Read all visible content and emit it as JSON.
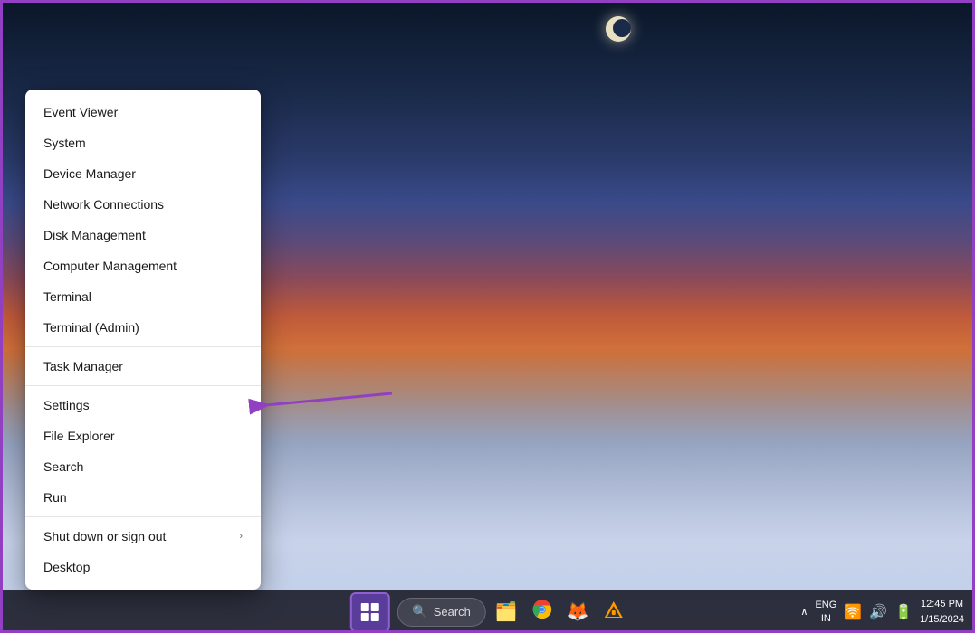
{
  "desktop": {
    "background_desc": "Winter landscape at dusk with snow fields"
  },
  "context_menu": {
    "items": [
      {
        "id": "event-viewer",
        "label": "Event Viewer",
        "has_submenu": false
      },
      {
        "id": "system",
        "label": "System",
        "has_submenu": false
      },
      {
        "id": "device-manager",
        "label": "Device Manager",
        "has_submenu": false
      },
      {
        "id": "network-connections",
        "label": "Network Connections",
        "has_submenu": false
      },
      {
        "id": "disk-management",
        "label": "Disk Management",
        "has_submenu": false
      },
      {
        "id": "computer-management",
        "label": "Computer Management",
        "has_submenu": false
      },
      {
        "id": "terminal",
        "label": "Terminal",
        "has_submenu": false
      },
      {
        "id": "terminal-admin",
        "label": "Terminal (Admin)",
        "has_submenu": false
      },
      {
        "id": "task-manager",
        "label": "Task Manager",
        "has_submenu": false
      },
      {
        "id": "settings",
        "label": "Settings",
        "has_submenu": false,
        "highlighted": true
      },
      {
        "id": "file-explorer",
        "label": "File Explorer",
        "has_submenu": false
      },
      {
        "id": "search",
        "label": "Search",
        "has_submenu": false
      },
      {
        "id": "run",
        "label": "Run",
        "has_submenu": false
      },
      {
        "id": "shut-down",
        "label": "Shut down or sign out",
        "has_submenu": true
      },
      {
        "id": "desktop",
        "label": "Desktop",
        "has_submenu": false
      }
    ],
    "divider_after": [
      "terminal-admin",
      "task-manager",
      "run"
    ]
  },
  "taskbar": {
    "search_placeholder": "Search",
    "search_label": "Search",
    "icons": [
      {
        "id": "file-explorer",
        "symbol": "🗂️",
        "label": "File Explorer"
      },
      {
        "id": "chrome",
        "symbol": "🌐",
        "label": "Google Chrome"
      },
      {
        "id": "firefox",
        "symbol": "🦊",
        "label": "Firefox"
      },
      {
        "id": "vlc",
        "symbol": "🔶",
        "label": "VLC"
      }
    ],
    "sys_tray": {
      "chevron": "^",
      "lang": "ENG\nIN",
      "wifi": "WiFi",
      "volume": "Vol",
      "battery": "Bat",
      "time": "12:45 PM",
      "date": "1/15/2024"
    }
  },
  "annotation": {
    "arrow_color": "#9040c0",
    "points_to": "settings"
  }
}
